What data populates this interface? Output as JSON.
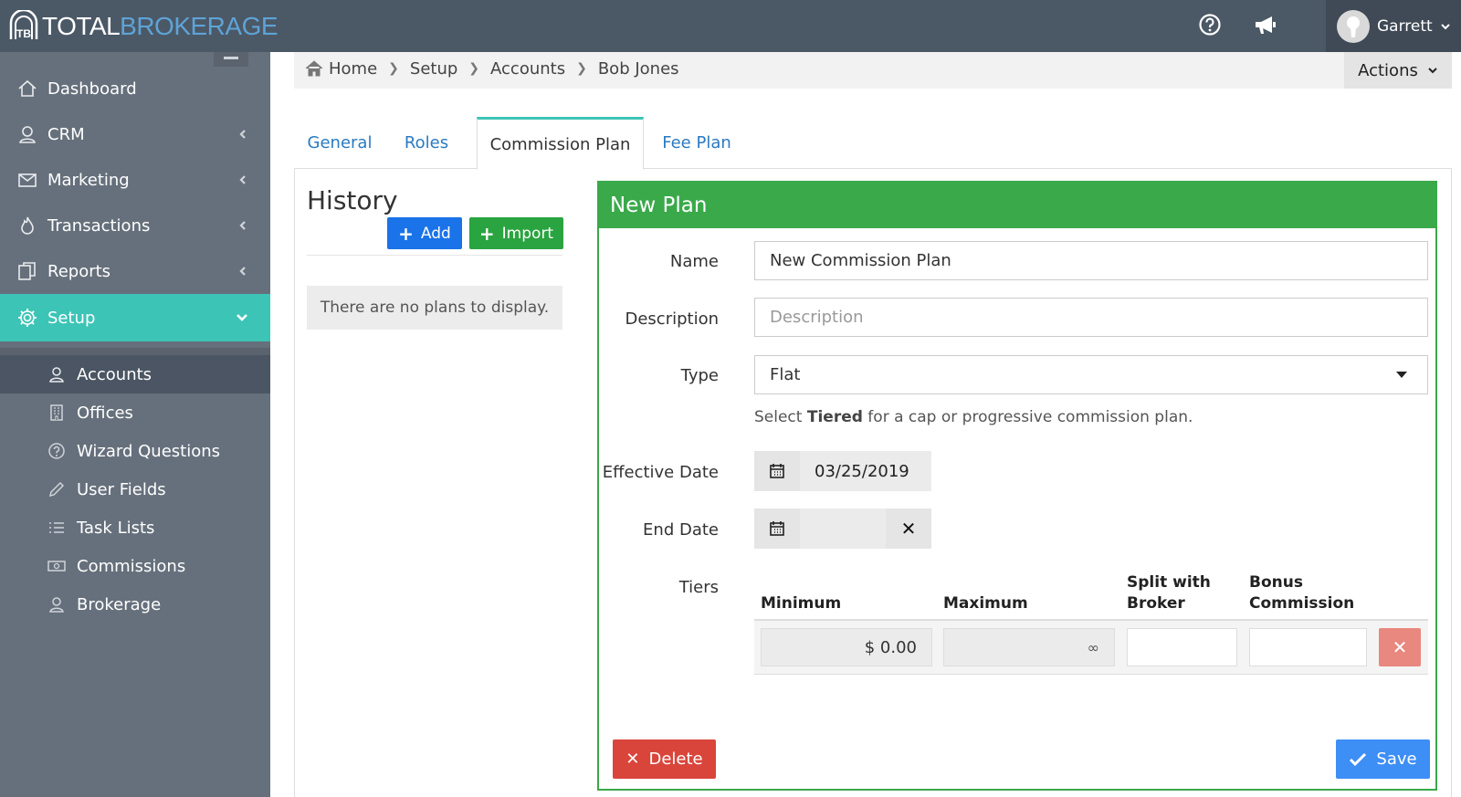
{
  "brand": {
    "word1": "TOTAL",
    "word2": "BROKERAGE",
    "mark": "TB"
  },
  "topbar": {
    "user_name": "Garrett"
  },
  "sidebar": {
    "items": [
      {
        "label": "Dashboard"
      },
      {
        "label": "CRM"
      },
      {
        "label": "Marketing"
      },
      {
        "label": "Transactions"
      },
      {
        "label": "Reports"
      },
      {
        "label": "Setup"
      }
    ],
    "sub_items": [
      {
        "label": "Accounts"
      },
      {
        "label": "Offices"
      },
      {
        "label": "Wizard Questions"
      },
      {
        "label": "User Fields"
      },
      {
        "label": "Task Lists"
      },
      {
        "label": "Commissions"
      },
      {
        "label": "Brokerage"
      }
    ]
  },
  "breadcrumb": [
    "Home",
    "Setup",
    "Accounts",
    "Bob Jones"
  ],
  "actions_label": "Actions",
  "tabs": [
    {
      "label": "General"
    },
    {
      "label": "Roles"
    },
    {
      "label": "Commission Plan"
    },
    {
      "label": "Fee Plan"
    }
  ],
  "history": {
    "title": "History",
    "add_label": "Add",
    "import_label": "Import",
    "empty_text": "There are no plans to display."
  },
  "plan": {
    "title": "New Plan",
    "name_label": "Name",
    "name_value": "New Commission Plan",
    "description_label": "Description",
    "description_placeholder": "Description",
    "type_label": "Type",
    "type_value": "Flat",
    "type_help_pre": "Select ",
    "type_help_bold": "Tiered",
    "type_help_post": " for a cap or progressive commission plan.",
    "effective_label": "Effective Date",
    "effective_value": "03/25/2019",
    "end_label": "End Date",
    "end_value": "",
    "tiers_label": "Tiers",
    "tier_headers": {
      "minimum": "Minimum",
      "maximum": "Maximum",
      "split_1": "Split with",
      "split_2": "Broker",
      "bonus_1": "Bonus",
      "bonus_2": "Commission"
    },
    "tier_rows": [
      {
        "minimum": "$ 0.00",
        "maximum": "∞",
        "split": "",
        "bonus": ""
      }
    ],
    "delete_label": "Delete",
    "save_label": "Save"
  }
}
